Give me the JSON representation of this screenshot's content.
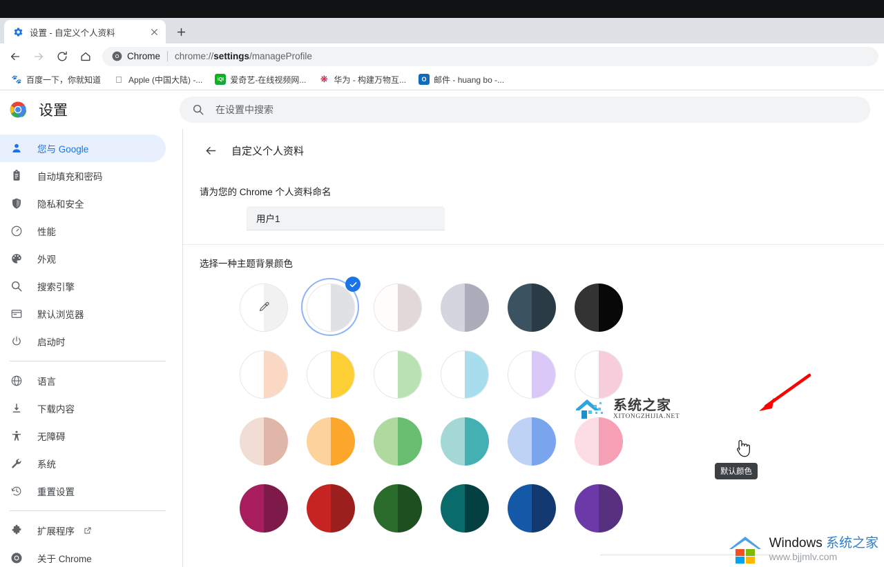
{
  "window": {
    "tab": {
      "title": "设置 - 自定义个人资料",
      "favicon": "settings-gear-icon",
      "close_label": "×"
    },
    "new_tab_label": "+",
    "toolbar": {
      "back_label": "←",
      "forward_label": "→",
      "reload_label": "⟳",
      "home_label": "⌂",
      "omnibox": {
        "badge_label": "Chrome",
        "url_prefix": "chrome://",
        "url_bold": "settings",
        "url_suffix": "/manageProfile"
      }
    },
    "bookmarks": [
      {
        "label": "百度一下，你就知道",
        "icon": "baidu-icon",
        "glyph": "百"
      },
      {
        "label": "Apple (中国大陆) -...",
        "icon": "apple-icon",
        "glyph": ""
      },
      {
        "label": "爱奇艺-在线视频网...",
        "icon": "iqiyi-icon",
        "glyph": "iQI"
      },
      {
        "label": "华为 - 构建万物互...",
        "icon": "huawei-icon",
        "glyph": "❋"
      },
      {
        "label": "邮件 - huang bo -...",
        "icon": "outlook-mail-icon",
        "glyph": "O"
      }
    ]
  },
  "settings": {
    "brand_title": "设置",
    "brand_icon": "chrome-logo-icon",
    "search": {
      "placeholder": "在设置中搜索",
      "value": "",
      "icon": "search-icon"
    },
    "sidebar": {
      "items": [
        {
          "label": "您与 Google",
          "icon": "person-icon",
          "active": true
        },
        {
          "label": "自动填充和密码",
          "icon": "clipboard-icon",
          "active": false
        },
        {
          "label": "隐私和安全",
          "icon": "shield-icon",
          "active": false
        },
        {
          "label": "性能",
          "icon": "speedometer-icon",
          "active": false
        },
        {
          "label": "外观",
          "icon": "palette-icon",
          "active": false
        },
        {
          "label": "搜索引擎",
          "icon": "search-icon",
          "active": false
        },
        {
          "label": "默认浏览器",
          "icon": "browser-window-icon",
          "active": false
        },
        {
          "label": "启动时",
          "icon": "power-icon",
          "active": false
        }
      ],
      "items2": [
        {
          "label": "语言",
          "icon": "globe-icon"
        },
        {
          "label": "下载内容",
          "icon": "download-icon"
        },
        {
          "label": "无障碍",
          "icon": "accessibility-icon"
        },
        {
          "label": "系统",
          "icon": "wrench-icon"
        },
        {
          "label": "重置设置",
          "icon": "history-restore-icon"
        }
      ],
      "items3": [
        {
          "label": "扩展程序",
          "icon": "puzzle-icon",
          "external": true,
          "external_icon": "open-in-new-icon"
        },
        {
          "label": "关于 Chrome",
          "icon": "chrome-outline-icon",
          "external": false
        }
      ]
    },
    "page": {
      "back_icon": "arrow-left-icon",
      "breadcrumb_title": "自定义个人资料",
      "name_label": "请为您的 Chrome 个人资料命名",
      "name_value": "用户1",
      "name_placeholder": "",
      "color_label": "选择一种主题背景颜色",
      "tooltip": "默认颜色",
      "selected_index": 1,
      "accent_color": "#1a73e8",
      "ring_color": "#8ab4f8"
    },
    "swatches": [
      {
        "name": "custom-color-picker",
        "left": "#ffffff",
        "right": "#f1f1f1",
        "bordered": true,
        "eyedropper": true
      },
      {
        "name": "default-color",
        "left": "#ffffff",
        "right": "#dfe1e5",
        "bordered": true,
        "eyedropper": false,
        "selected": true
      },
      {
        "name": "warm-grey-color",
        "left": "#fffcfb",
        "right": "#e1d9d7",
        "bordered": true,
        "eyedropper": false
      },
      {
        "name": "cool-grey-color",
        "left": "#d3d6de",
        "right": "#abaeba",
        "bordered": false,
        "eyedropper": false
      },
      {
        "name": "dark-slate-color",
        "left": "#3b5360",
        "right": "#2b3b45",
        "bordered": false,
        "eyedropper": false
      },
      {
        "name": "black-color",
        "left": "#333333",
        "right": "#080808",
        "bordered": false,
        "eyedropper": false
      },
      {
        "name": "pale-peach-color",
        "left": "#ffffff",
        "right": "#fad8c3",
        "bordered": true,
        "eyedropper": false
      },
      {
        "name": "yellow-color",
        "left": "#ffffff",
        "right": "#fcd034",
        "bordered": true,
        "eyedropper": false
      },
      {
        "name": "pale-green-color",
        "left": "#ffffff",
        "right": "#b9e2b3",
        "bordered": true,
        "eyedropper": false
      },
      {
        "name": "pale-cyan-color",
        "left": "#ffffff",
        "right": "#a8ddee",
        "bordered": true,
        "eyedropper": false
      },
      {
        "name": "pale-purple-color",
        "left": "#ffffff",
        "right": "#d9c7f7",
        "bordered": true,
        "eyedropper": false
      },
      {
        "name": "pale-pink-color",
        "left": "#ffffff",
        "right": "#f6cedb",
        "bordered": true,
        "eyedropper": false
      },
      {
        "name": "rose-beige-color",
        "left": "#f0ded5",
        "right": "#dfb6a8",
        "bordered": false,
        "eyedropper": false
      },
      {
        "name": "orange-color",
        "left": "#fcd39b",
        "right": "#fca72b",
        "bordered": false,
        "eyedropper": false
      },
      {
        "name": "green-color",
        "left": "#aeda9f",
        "right": "#68bd70",
        "bordered": false,
        "eyedropper": false
      },
      {
        "name": "teal-color",
        "left": "#a4d8d6",
        "right": "#45b0b4",
        "bordered": false,
        "eyedropper": false
      },
      {
        "name": "blue-color",
        "left": "#bed2f5",
        "right": "#7ba4ee",
        "bordered": false,
        "eyedropper": false
      },
      {
        "name": "pink-color",
        "left": "#fcdde4",
        "right": "#f79fb4",
        "bordered": false,
        "eyedropper": false
      },
      {
        "name": "magenta-color",
        "left": "#a81d5e",
        "right": "#7d1a49",
        "bordered": false,
        "eyedropper": false
      },
      {
        "name": "red-color",
        "left": "#c62423",
        "right": "#9b1f1c",
        "bordered": false,
        "eyedropper": false
      },
      {
        "name": "forest-green-color",
        "left": "#2b6b2c",
        "right": "#1d4f21",
        "bordered": false,
        "eyedropper": false
      },
      {
        "name": "dark-teal-color",
        "left": "#0a6b6b",
        "right": "#043f42",
        "bordered": false,
        "eyedropper": false
      },
      {
        "name": "navy-color",
        "left": "#1359a8",
        "right": "#123a70",
        "bordered": false,
        "eyedropper": false
      },
      {
        "name": "purple-color",
        "left": "#6b39a8",
        "right": "#57307f",
        "bordered": false,
        "eyedropper": false
      }
    ]
  },
  "annotations": {
    "arrow_color": "#ff0000",
    "watermark_center": {
      "cn": "系统之家",
      "en": "XITONGZHIJIA.NET"
    },
    "watermark_bottom": {
      "brand": "Windows ",
      "cn": "系统之家",
      "url": "www.bjjmlv.com"
    }
  }
}
